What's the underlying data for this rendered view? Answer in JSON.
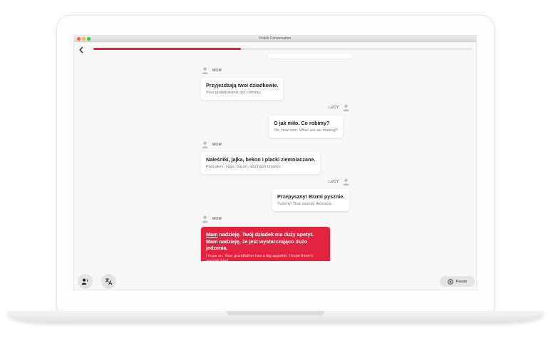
{
  "window": {
    "title": "Polish Conversation"
  },
  "progress": {
    "fraction": 0.39
  },
  "messages": [
    {
      "speaker": "MOM",
      "side": "left",
      "polish": "Przyjeżdżają twoi dziadkowie.",
      "english": "Your grandparents are coming."
    },
    {
      "speaker": "LUCY",
      "side": "right",
      "polish": "O jak miło. Co robimy?",
      "english": "Oh, how nice. What are we making?"
    },
    {
      "speaker": "MOM",
      "side": "left",
      "polish": "Naleśniki, jajka, bekon i placki ziemniaczane.",
      "english": "Pancakes, eggs, bacon, and hash browns."
    },
    {
      "speaker": "LUCY",
      "side": "right",
      "polish": "Przepyszny! Brzmi pysznie.",
      "english": "Yummy! That sounds delicious."
    },
    {
      "speaker": "MOM",
      "side": "left",
      "polish_highlight": "Mam",
      "polish_rest": " nadzieję. Twój dziadek ma duży apetyt. Mam nadzieję, że jest wystarczająco dużo jedzenia.",
      "english": "I hope so. Your grandfather has a big appetite. I hope there's enough food."
    }
  ],
  "controls": {
    "pause_label": "Pause"
  },
  "colors": {
    "accent": "#e2233f",
    "background": "#f7f7f7"
  },
  "icons": {
    "back": "chevron-left-icon",
    "person": "person-icon",
    "speak": "speak-icon",
    "translate": "translate-icon",
    "pause": "pause-icon"
  }
}
